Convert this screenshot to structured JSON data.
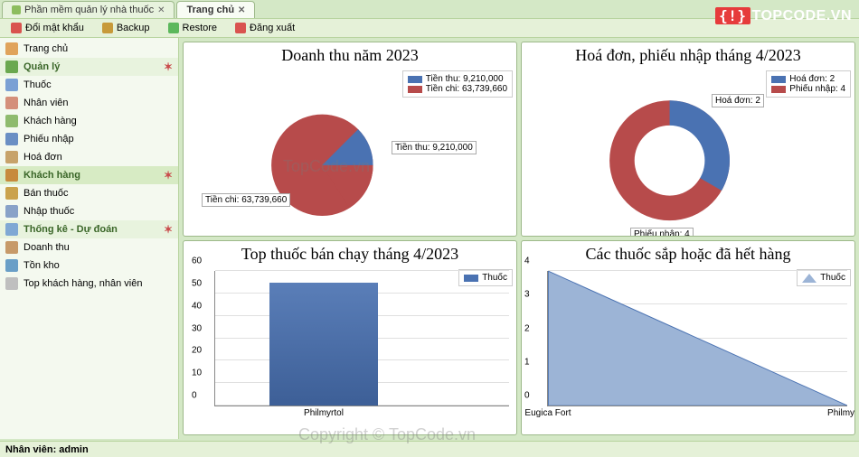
{
  "tabs": [
    {
      "label": "Phần mềm quản lý nhà thuốc",
      "active": false
    },
    {
      "label": "Trang chủ",
      "active": true
    }
  ],
  "toolbar": {
    "change_password": "Đổi mật khẩu",
    "backup": "Backup",
    "restore": "Restore",
    "logout": "Đăng xuất"
  },
  "sidebar": {
    "home": "Trang chủ",
    "group_manage": "Quản lý",
    "items_manage": [
      "Thuốc",
      "Nhân viên",
      "Khách hàng",
      "Phiếu nhập",
      "Hoá đơn"
    ],
    "group_customer": "Khách hàng",
    "items_customer": [
      "Bán thuốc",
      "Nhập thuốc"
    ],
    "group_stats": "Thống kê - Dự đoán",
    "items_stats": [
      "Doanh thu",
      "Tồn kho",
      "Top khách hàng, nhân viên"
    ]
  },
  "status": {
    "label": "Nhân viên:",
    "user": "admin"
  },
  "logo": {
    "text": "TOPCODE.VN"
  },
  "watermarks": {
    "w1": "TopCode.vn",
    "w2": "Copyright © TopCode.vn"
  },
  "chart_data": [
    {
      "id": "revenue",
      "type": "pie",
      "title": "Doanh thu năm 2023",
      "series": [
        {
          "name": "Tiền thu",
          "value": 9210000,
          "display": "Tiền thu: 9,210,000",
          "color": "#4a72b2"
        },
        {
          "name": "Tiền chi",
          "value": 63739660,
          "display": "Tiền chi: 63,739,660",
          "color": "#b74b4b"
        }
      ],
      "callouts": [
        {
          "text": "Tiền thu: 9,210,000"
        },
        {
          "text": "Tiền chi: 63,739,660"
        }
      ]
    },
    {
      "id": "invoice_import",
      "type": "donut",
      "title": "Hoá đơn, phiếu nhập tháng 4/2023",
      "series": [
        {
          "name": "Hoá đơn",
          "value": 2,
          "display": "Hoá đơn: 2",
          "color": "#4a72b2"
        },
        {
          "name": "Phiếu nhập",
          "value": 4,
          "display": "Phiếu nhập: 4",
          "color": "#b74b4b"
        }
      ],
      "callouts": [
        {
          "text": "Hoá đơn: 2"
        },
        {
          "text": "Phiếu nhập: 4"
        }
      ]
    },
    {
      "id": "top_selling",
      "type": "bar",
      "title": "Top thuốc bán chạy tháng 4/2023",
      "legend": "Thuốc",
      "ylim": [
        0,
        60
      ],
      "ytick": 10,
      "categories": [
        "Philmyrtol"
      ],
      "values": [
        55
      ]
    },
    {
      "id": "low_stock",
      "type": "area",
      "title": "Các thuốc sắp hoặc đã hết hàng",
      "legend": "Thuốc",
      "ylim": [
        0,
        4
      ],
      "ytick": 1,
      "categories": [
        "Eugica Fort",
        "Philmyrtol"
      ],
      "values": [
        4,
        0
      ]
    }
  ]
}
